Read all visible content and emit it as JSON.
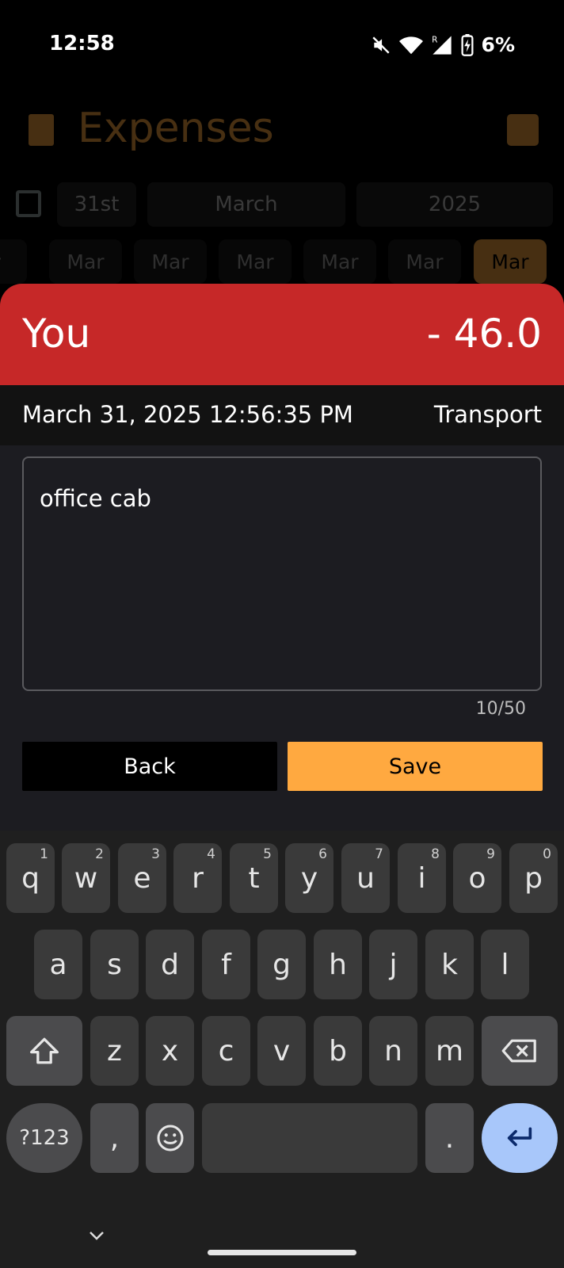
{
  "status": {
    "time": "12:58",
    "battery": "6%"
  },
  "background": {
    "title": "Expenses",
    "date": {
      "day": "31st",
      "month": "March",
      "year": "2025"
    },
    "months": [
      "ar",
      "Mar",
      "Mar",
      "Mar",
      "Mar",
      "Mar",
      "Mar"
    ]
  },
  "entry": {
    "payer": "You",
    "amount": "- 46.0",
    "datetime": "March 31, 2025 12:56:35 PM",
    "category": "Transport",
    "note": "office cab",
    "char_count": "10/50",
    "back_label": "Back",
    "save_label": "Save"
  },
  "keyboard": {
    "row1": [
      [
        "q",
        "1"
      ],
      [
        "w",
        "2"
      ],
      [
        "e",
        "3"
      ],
      [
        "r",
        "4"
      ],
      [
        "t",
        "5"
      ],
      [
        "y",
        "6"
      ],
      [
        "u",
        "7"
      ],
      [
        "i",
        "8"
      ],
      [
        "o",
        "9"
      ],
      [
        "p",
        "0"
      ]
    ],
    "row2": [
      "a",
      "s",
      "d",
      "f",
      "g",
      "h",
      "j",
      "k",
      "l"
    ],
    "row3": [
      "z",
      "x",
      "c",
      "v",
      "b",
      "n",
      "m"
    ],
    "symbols_label": "?123",
    "comma": ",",
    "period": "."
  },
  "colors": {
    "accent": "#ffa940",
    "expense_red": "#c62828",
    "enter_key": "#a8c7fa"
  }
}
